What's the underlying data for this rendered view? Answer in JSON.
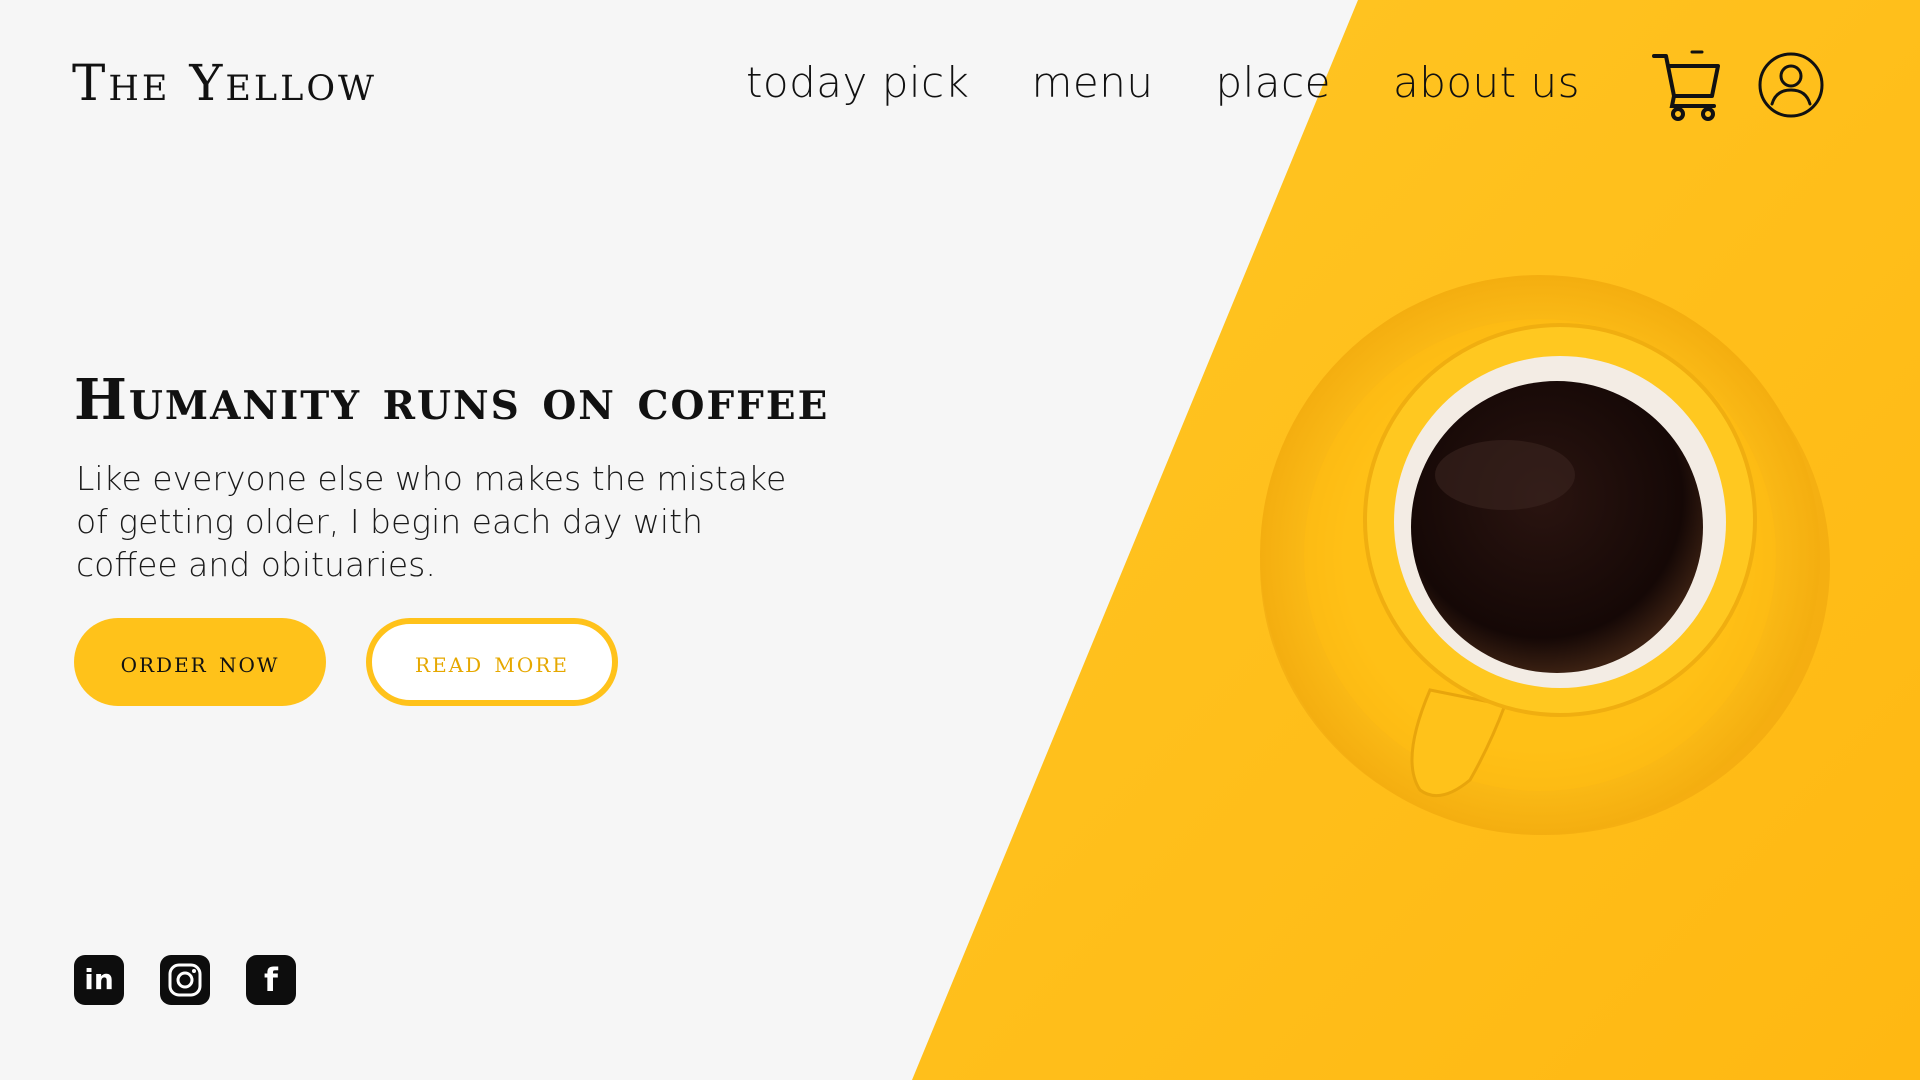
{
  "brand": {
    "name": "The Yellow",
    "accent_color": "#FFC21A"
  },
  "nav": {
    "items": [
      {
        "label": "today pick"
      },
      {
        "label": "menu"
      },
      {
        "label": "place"
      },
      {
        "label": "about us"
      }
    ],
    "cart_icon": "shopping-cart-icon",
    "user_icon": "user-account-icon"
  },
  "hero": {
    "headline": "Humanity runs on coffee",
    "subtext_lines": [
      "Like everyone else who makes the mistake",
      "of getting older, I begin each day with",
      "coffee and obituaries."
    ],
    "primary_button": "order now",
    "secondary_button": "read more"
  },
  "social": {
    "icons": [
      "linkedin-icon",
      "instagram-icon",
      "facebook-icon"
    ],
    "linkedin_label": "in",
    "facebook_label": "f"
  },
  "colors": {
    "background": "#f6f6f6",
    "yellow": "#FFC21A",
    "text": "#111111",
    "coffee": "#1a0c0a"
  }
}
